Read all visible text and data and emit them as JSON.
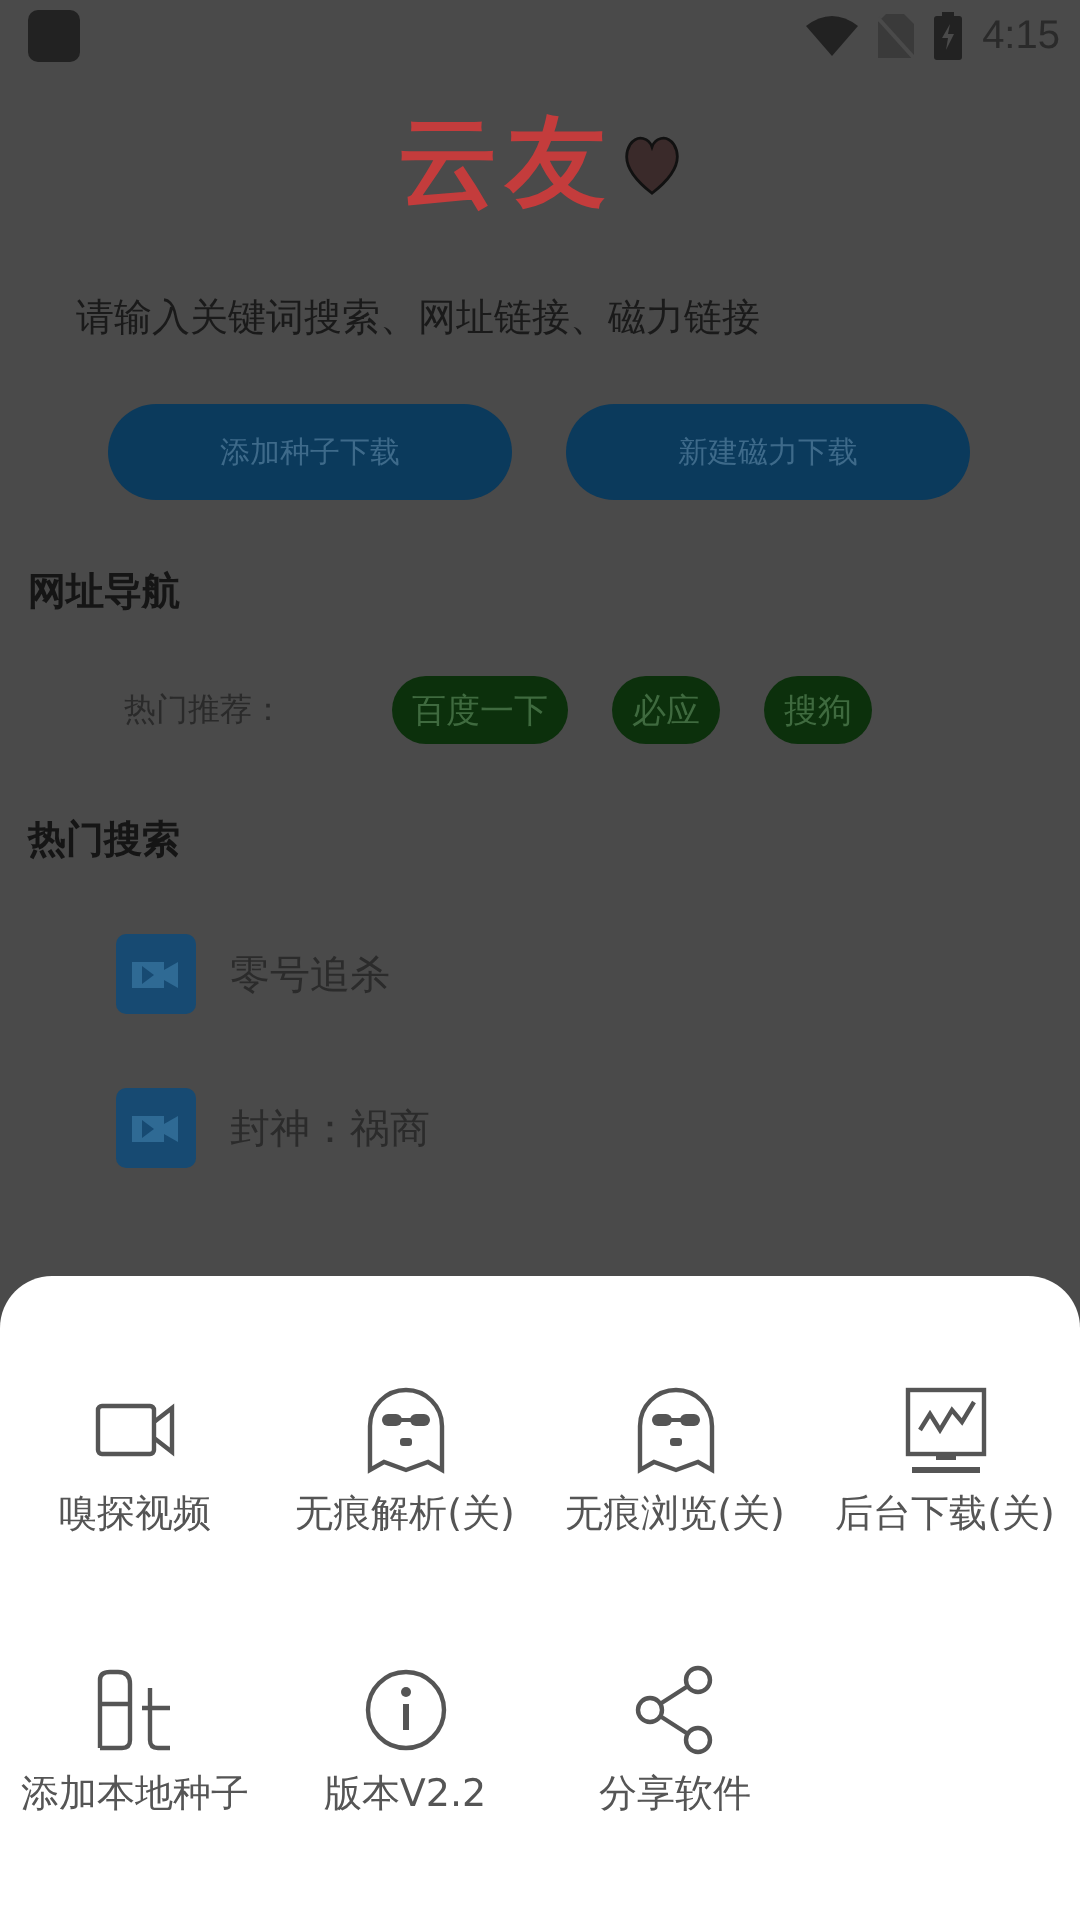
{
  "status_bar": {
    "time": "4:15"
  },
  "logo": {
    "text": "云友"
  },
  "search": {
    "placeholder": "请输入关键词搜索、网址链接、磁力链接"
  },
  "actions": [
    "添加种子下载",
    "新建磁力下载"
  ],
  "nav": {
    "title": "网址导航",
    "label": "热门推荐：",
    "links": [
      "百度一下",
      "必应",
      "搜狗"
    ]
  },
  "hot": {
    "title": "热门搜索",
    "items": [
      "零号追杀",
      "封神：祸商"
    ]
  },
  "sheet": {
    "items": [
      {
        "label": "嗅探视频"
      },
      {
        "label": "无痕解析(关)"
      },
      {
        "label": "无痕浏览(关)"
      },
      {
        "label": "后台下载(关)"
      },
      {
        "label": "添加本地种子"
      },
      {
        "label": "版本V2.2"
      },
      {
        "label": "分享软件"
      }
    ]
  }
}
